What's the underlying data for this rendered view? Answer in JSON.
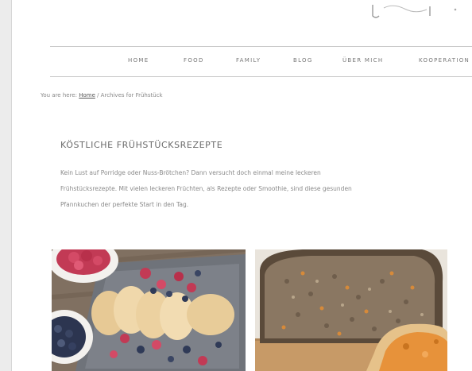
{
  "nav": {
    "items": [
      "HOME",
      "FOOD",
      "FAMILY",
      "BLOG",
      "ÜBER MICH",
      "KOOPERATION"
    ]
  },
  "breadcrumb": {
    "prefix": "You are here: ",
    "home": "Home",
    "rest": " / Archives for Frühstück"
  },
  "main": {
    "title": "KÖSTLICHE FRÜHSTÜCKSREZEPTE",
    "intro": [
      "Kein Lust auf Porridge oder Nuss-Brötchen? Dann versucht doch einmal meine leckeren",
      "Frühstücksrezepte. Mit vielen leckeren Früchten, als Rezepte oder Smoothie, sind diese gesunden",
      "Pfannkuchen der perfekte Start in den Tag."
    ]
  },
  "cards": [
    {
      "name": "pancakes-berries-image"
    },
    {
      "name": "bread-loaf-image"
    }
  ],
  "colors": {
    "page_bg": "#ffffff",
    "outer_bg": "#ececec",
    "nav_text": "#777777",
    "rule": "#c9c9c9"
  }
}
